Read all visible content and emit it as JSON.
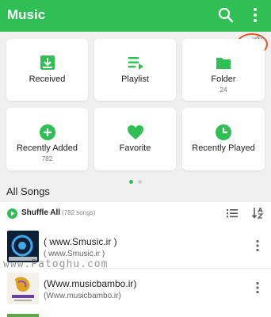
{
  "app": {
    "title": "Music"
  },
  "colors": {
    "accent": "#2fbf55",
    "background": "#f0f0f0",
    "card": "#ffffff"
  },
  "toolbar": {
    "icons": [
      "search-icon",
      "more-vert-icon"
    ]
  },
  "watermark_logo_text": "آلاوم",
  "categories": [
    {
      "label": "Received",
      "count": "",
      "icon": "download-icon"
    },
    {
      "label": "Playlist",
      "count": "",
      "icon": "playlist-icon"
    },
    {
      "label": "Folder",
      "count": "24",
      "icon": "folder-icon"
    },
    {
      "label": "Recently Added",
      "count": "782",
      "icon": "add-circle-icon"
    },
    {
      "label": "Favorite",
      "count": "",
      "icon": "heart-icon"
    },
    {
      "label": "Recently Played",
      "count": "",
      "icon": "clock-icon"
    }
  ],
  "pager": {
    "pages": 2,
    "current": 1
  },
  "all_songs": {
    "title": "All Songs",
    "shuffle_label": "Shuffle All",
    "count_label": "(782 songs)"
  },
  "songs": [
    {
      "title": "( www.Smusic.ir )",
      "subtitle": "( www.Smusic.ir )"
    },
    {
      "title": "(Www.musicbambo.ir)",
      "subtitle": "(Www.musicbambo.ir)"
    }
  ],
  "overlay_watermark": "www.Patoghu.com"
}
